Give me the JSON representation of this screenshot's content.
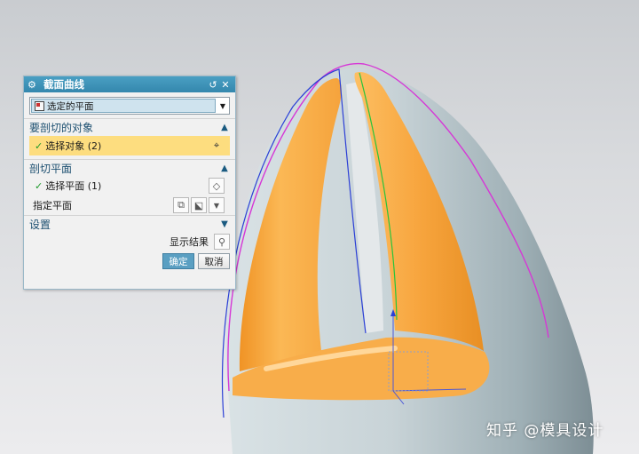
{
  "dialog": {
    "title": "截面曲线",
    "type_select": {
      "value": "选定的平面"
    },
    "section_objects": {
      "title": "要剖切的对象",
      "select_label": "选择对象 (2)"
    },
    "section_plane": {
      "title": "剖切平面",
      "select_label": "选择平面 (1)",
      "specify_label": "指定平面"
    },
    "settings": {
      "title": "设置"
    },
    "show_result_label": "显示结果",
    "ok_label": "确定",
    "cancel_label": "取消"
  },
  "watermark": "知乎 @模具设计",
  "colors": {
    "title_bar": "#3c93b9",
    "active_row": "#fddd7f",
    "ok_button": "#5a9fc2",
    "model_orange": "#f6a43c",
    "model_gray": "#bcc7cb"
  },
  "icons": {
    "gear": "gear-icon",
    "reset": "reset-icon",
    "close": "close-icon",
    "crosshair": "crosshair-icon",
    "plane": "plane-icon",
    "magnifier": "magnifier-icon"
  }
}
